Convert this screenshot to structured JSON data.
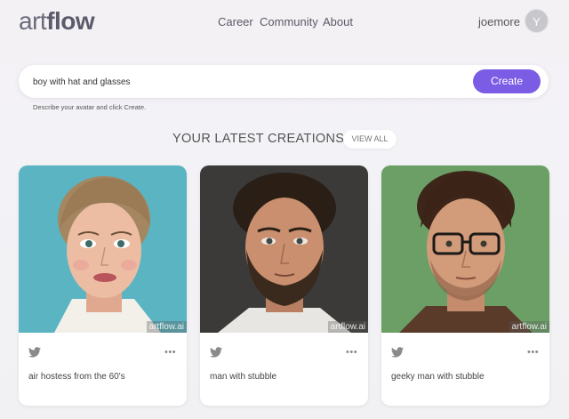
{
  "brand": {
    "logo_bold": "art",
    "logo_light": "flow"
  },
  "nav": {
    "career": "Career",
    "community": "Community",
    "about": "About"
  },
  "user": {
    "name": "joemore",
    "initial": "Y"
  },
  "search": {
    "value": "boy with hat and glasses",
    "create_label": "Create",
    "hint": "Describe your avatar and click Create."
  },
  "section": {
    "title": "YOUR LATEST CREATIONS",
    "view_all": "VIEW ALL"
  },
  "cards": [
    {
      "title": "air hostess from the 60's",
      "watermark": "artflow.ai",
      "bg": "#5bb5c2"
    },
    {
      "title": "man with stubble",
      "watermark": "artflow.ai",
      "bg": "#3b3b3a"
    },
    {
      "title": "geeky man with stubble",
      "watermark": "artflow.ai",
      "bg": "#6a9e64"
    }
  ],
  "colors": {
    "accent": "#7b5ce5"
  }
}
